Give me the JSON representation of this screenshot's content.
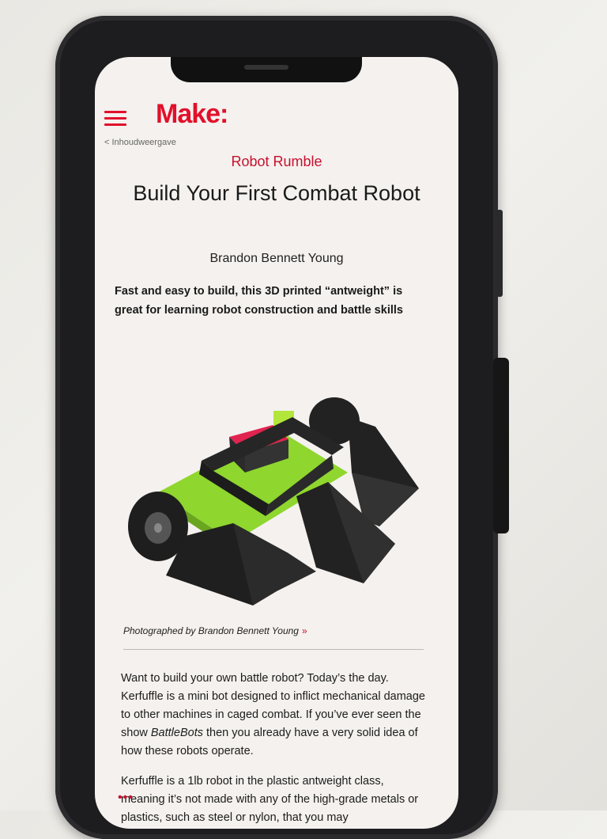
{
  "header": {
    "logo": "Make:",
    "back_link": "< Inhoudweergave"
  },
  "article": {
    "kicker": "Robot Rumble",
    "title": "Build Your First Combat Robot",
    "author": "Brandon Bennett Young",
    "dek": "Fast and easy to build, this 3D printed “antweight” is great for learning robot construction and battle skills",
    "caption": "Photographed by Brandon Bennett Young",
    "caption_arrow": "»",
    "paragraphs": [
      {
        "before": "Want to build your own battle robot? Today’s the day. Kerfuffle is a mini bot designed to inflict mechanical damage to other machines in caged combat. If you’ve ever seen the show ",
        "em": "BattleBots",
        "after": " then you already have a very solid idea of how these robots operate."
      },
      {
        "text": "Kerfuffle is a 1lb robot in the plastic antweight class, meaning it’s not made with any of the high-grade metals or plastics, such as steel or nylon, that you may"
      }
    ],
    "more_dots": "•••"
  },
  "colors": {
    "brand_red": "#e2102b",
    "kicker_red": "#c8102e",
    "robot_green": "#8fd62e",
    "servo_pink": "#e0234f"
  }
}
